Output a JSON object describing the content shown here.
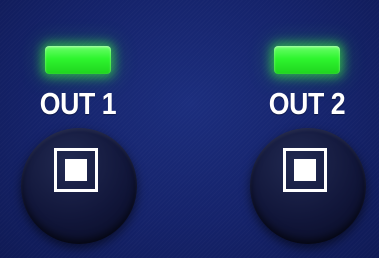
{
  "outputs": [
    {
      "label": "OUT 1",
      "led_state": "on",
      "led_color": "#2ef52e",
      "button_icon": "stop-square-icon"
    },
    {
      "label": "OUT 2",
      "led_state": "on",
      "led_color": "#2ef52e",
      "button_icon": "stop-square-icon"
    }
  ],
  "colors": {
    "panel_background": "#15236b",
    "led_on": "#2ef52e",
    "label_text": "#ffffff",
    "button_face": "#11163a"
  }
}
